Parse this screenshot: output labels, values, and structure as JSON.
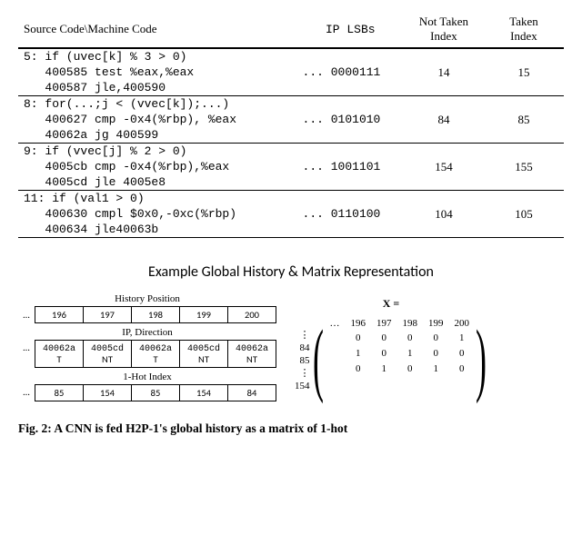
{
  "headers": {
    "col1": "Source Code\\Machine Code",
    "col2": "IP LSBs",
    "col3_l1": "Not Taken",
    "col3_l2": "Index",
    "col4_l1": "Taken",
    "col4_l2": "Index"
  },
  "rows": [
    {
      "src": "5: if (uvec[k] % 3 > 0)",
      "asm1": "   400585 test %eax,%eax",
      "asm2": "   400587 jle,400590",
      "ip": "... 0000111",
      "nt": "14",
      "t": "15"
    },
    {
      "src": "8: for(...;j < (vvec[k]);...)",
      "asm1": "   400627 cmp -0x4(%rbp), %eax",
      "asm2": "   40062a jg 400599",
      "ip": "... 0101010",
      "nt": "84",
      "t": "85"
    },
    {
      "src": "9: if (vvec[j] % 2 > 0)",
      "asm1": "   4005cb cmp -0x4(%rbp),%eax",
      "asm2": "   4005cd jle 4005e8",
      "ip": "... 1001101",
      "nt": "154",
      "t": "155"
    },
    {
      "src": "11: if (val1 > 0)",
      "asm1": "   400630 cmpl $0x0,-0xc(%rbp)",
      "asm2": "   400634 jle40063b",
      "ip": "... 0110100",
      "nt": "104",
      "t": "105"
    }
  ],
  "example_title": "Example Global History & Matrix Representation",
  "hist": {
    "label_pos": "History Position",
    "pos": [
      "196",
      "197",
      "198",
      "199",
      "200"
    ],
    "label_ipdir": "IP, Direction",
    "ipdir": [
      {
        "ip": "40062a",
        "d": "T"
      },
      {
        "ip": "4005cd",
        "d": "NT"
      },
      {
        "ip": "40062a",
        "d": "T"
      },
      {
        "ip": "4005cd",
        "d": "NT"
      },
      {
        "ip": "40062a",
        "d": "NT"
      }
    ],
    "label_onehot": "1-Hot Index",
    "onehot": [
      "85",
      "154",
      "85",
      "154",
      "84"
    ]
  },
  "matrix": {
    "x_label": "X =",
    "cols": [
      "196",
      "197",
      "198",
      "199",
      "200"
    ],
    "row_labels": [
      "84",
      "85",
      "154"
    ],
    "chart_data": {
      "type": "table",
      "col_headers": [
        "196",
        "197",
        "198",
        "199",
        "200"
      ],
      "row_headers": [
        "84",
        "85",
        "154"
      ],
      "values": [
        [
          0,
          0,
          0,
          0,
          1
        ],
        [
          1,
          0,
          1,
          0,
          0
        ],
        [
          0,
          1,
          0,
          1,
          0
        ]
      ]
    }
  },
  "caption": "Fig. 2: A CNN is fed H2P-1's global history as a matrix of 1-hot"
}
